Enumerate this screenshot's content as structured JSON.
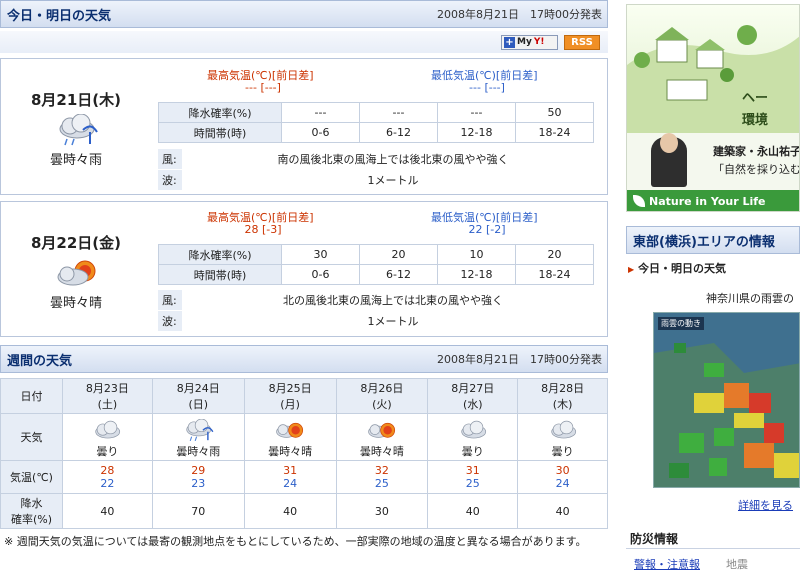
{
  "today_tomorrow": {
    "title": "今日・明日の天気",
    "issued": "2008年8月21日　17時00分発表",
    "myy_label": "My",
    "rss_label": "RSS",
    "max_temp_label": "最高気温(℃)[前日差]",
    "min_temp_label": "最低気温(℃)[前日差]",
    "rain_prob_label": "降水確率(%)",
    "time_label": "時間帯(時)",
    "wind_label": "風:",
    "wave_label": "波:",
    "days": [
      {
        "date": "8月21日(木)",
        "icon": "cloud-rain-icon",
        "condition": "曇時々雨",
        "max_temp": "--- [---]",
        "min_temp": "--- [---]",
        "rain_probs": [
          "---",
          "---",
          "---",
          "50"
        ],
        "periods": [
          "0-6",
          "6-12",
          "12-18",
          "18-24"
        ],
        "wind": "南の風後北東の風海上では後北東の風やや強く",
        "wave": "1メートル"
      },
      {
        "date": "8月22日(金)",
        "icon": "cloud-sun-icon",
        "condition": "曇時々晴",
        "max_temp": "28 [-3]",
        "min_temp": "22 [-2]",
        "rain_probs": [
          "30",
          "20",
          "10",
          "20"
        ],
        "periods": [
          "0-6",
          "6-12",
          "12-18",
          "18-24"
        ],
        "wind": "北の風後北東の風海上では北東の風やや強く",
        "wave": "1メートル"
      }
    ]
  },
  "weekly": {
    "title": "週間の天気",
    "issued": "2008年8月21日　17時00分発表",
    "row_labels": {
      "date": "日付",
      "weather": "天気",
      "temp": "気温(℃)",
      "rain_line1": "降水",
      "rain_line2": "確率(%)"
    },
    "days": [
      {
        "date": "8月23日",
        "dow": "(土)",
        "icon": "cloud-icon",
        "weather": "曇り",
        "max": "28",
        "min": "22",
        "rain": "40"
      },
      {
        "date": "8月24日",
        "dow": "(日)",
        "icon": "cloud-rain-icon",
        "weather": "曇時々雨",
        "max": "29",
        "min": "23",
        "rain": "70"
      },
      {
        "date": "8月25日",
        "dow": "(月)",
        "icon": "sun-cloud-icon",
        "weather": "曇時々晴",
        "max": "31",
        "min": "24",
        "rain": "40"
      },
      {
        "date": "8月26日",
        "dow": "(火)",
        "icon": "sun-cloud-icon",
        "weather": "曇時々晴",
        "max": "32",
        "min": "25",
        "rain": "30"
      },
      {
        "date": "8月27日",
        "dow": "(水)",
        "icon": "cloud-icon",
        "weather": "曇り",
        "max": "31",
        "min": "25",
        "rain": "40"
      },
      {
        "date": "8月28日",
        "dow": "(木)",
        "icon": "cloud-icon",
        "weather": "曇り",
        "max": "30",
        "min": "24",
        "rain": "40"
      }
    ],
    "note": "※ 週間天気の気温については最寄の観測地点をもとにしているため、一部実際の地域の温度と異なる場合があります。"
  },
  "sidebar": {
    "ad": {
      "heading_1": "ヘー",
      "heading_2": "環境",
      "line1": "建築家・永山祐子",
      "line2": "「自然を採り込む",
      "button": "Nature in Your Life"
    },
    "region_title": "東部(横浜)エリアの情報",
    "today_tomorrow": "今日・明日の天気",
    "rain_text": "神奈川県の雨雲の",
    "map_label": "雨雲の動き",
    "more_link": "詳細を見る",
    "disaster_title": "防災情報",
    "warning_link": "警報・注意報",
    "earthquake": "地震"
  },
  "colors": {
    "header_text": "#0b2f70",
    "max_temp": "#cc3300",
    "min_temp": "#2c5fc9",
    "label_bg": "#e7edf6",
    "link": "#1a3cb8"
  }
}
